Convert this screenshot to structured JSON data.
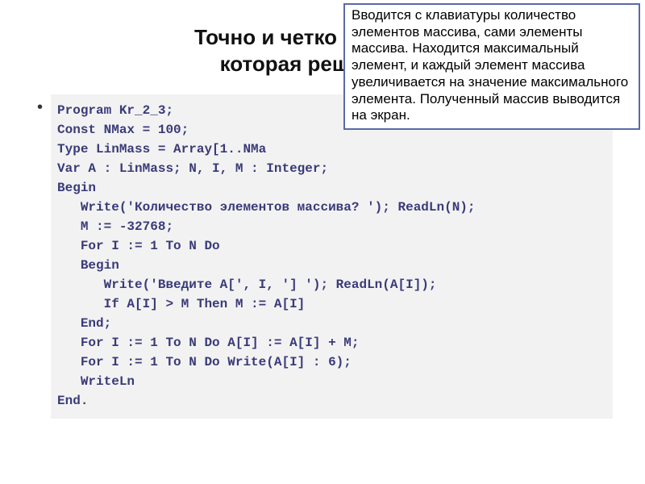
{
  "title_line1": "Точно и четко сформули",
  "title_line2": "которая решается в ",
  "callout_text": "Вводится с клавиатуры количество элементов массива, сами элементы массива. Находится максимальный элемент, и каждый элемент массива увеличивается на значение максимального элемента. Полученный массив выводится на экран.",
  "bullet": "•",
  "code": "Program Kr_2_3;\nConst NMax = 100;\nType LinMass = Array[1..NMa\nVar A : LinMass; N, I, M : Integer;\nBegin\n   Write('Количество элементов массива? '); ReadLn(N);\n   M := -32768;\n   For I := 1 To N Do\n   Begin\n      Write('Введите A[', I, '] '); ReadLn(A[I]);\n      If A[I] > M Then M := A[I]\n   End;\n   For I := 1 To N Do A[I] := A[I] + M;\n   For I := 1 To N Do Write(A[I] : 6);\n   WriteLn\nEnd."
}
